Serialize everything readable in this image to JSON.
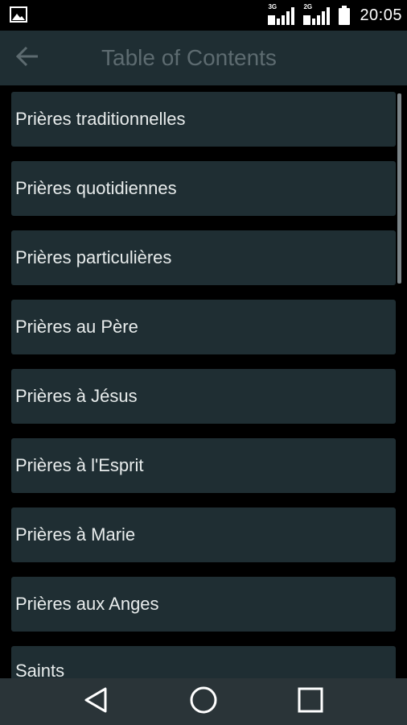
{
  "status_bar": {
    "time": "20:05",
    "signal1_network": "3G",
    "signal2_network": "2G",
    "icons": [
      "image-notification-icon",
      "signal-3g-icon",
      "signal-2g-icon",
      "battery-icon"
    ]
  },
  "app_bar": {
    "title": "Table of Contents",
    "back_icon": "arrow-back-icon"
  },
  "list": {
    "items": [
      {
        "label": "Prières traditionnelles"
      },
      {
        "label": "Prières quotidiennes"
      },
      {
        "label": "Prières particulières"
      },
      {
        "label": "Prières au Père"
      },
      {
        "label": "Prières à Jésus"
      },
      {
        "label": "Prières à l'Esprit"
      },
      {
        "label": "Prières à Marie"
      },
      {
        "label": "Prières aux Anges"
      },
      {
        "label": "Saints"
      }
    ]
  },
  "nav_bar": {
    "icons": [
      "back-triangle-icon",
      "home-circle-icon",
      "recents-square-icon"
    ]
  },
  "colors": {
    "app_bar": "#1f2e33",
    "item_bg": "#1f2e33",
    "title_text": "#5d6b70",
    "item_text": "#e8ecec",
    "nav_bar": "#2a3438"
  }
}
